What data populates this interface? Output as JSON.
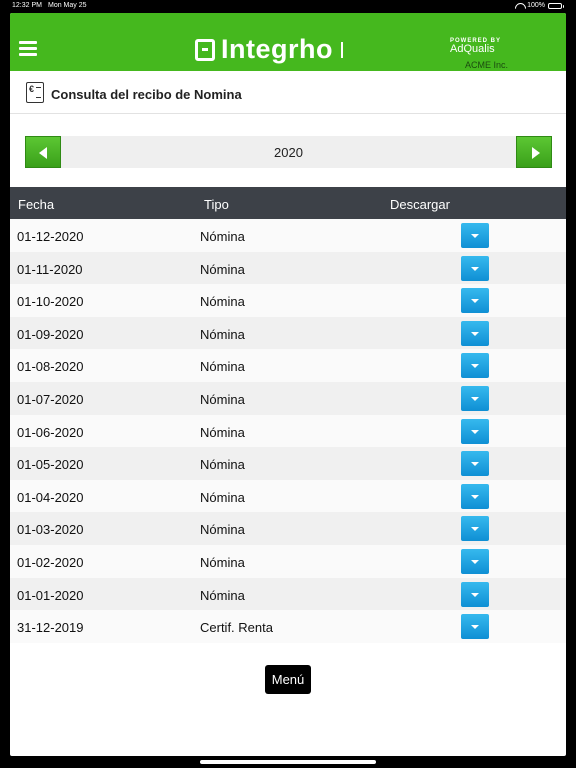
{
  "status": {
    "time": "12:32 PM",
    "date": "Mon May 25",
    "battery": "100%"
  },
  "header": {
    "brand": "Integrho",
    "powered_label": "POWERED BY",
    "powered_name": "AdQualis",
    "company": "ACME Inc."
  },
  "page": {
    "title": "Consulta del recibo de Nomina"
  },
  "year_selector": {
    "year": "2020"
  },
  "table": {
    "columns": [
      "Fecha",
      "Tipo",
      "Descargar"
    ],
    "rows": [
      {
        "fecha": "01-12-2020",
        "tipo": "Nómina"
      },
      {
        "fecha": "01-11-2020",
        "tipo": "Nómina"
      },
      {
        "fecha": "01-10-2020",
        "tipo": "Nómina"
      },
      {
        "fecha": "01-09-2020",
        "tipo": "Nómina"
      },
      {
        "fecha": "01-08-2020",
        "tipo": "Nómina"
      },
      {
        "fecha": "01-07-2020",
        "tipo": "Nómina"
      },
      {
        "fecha": "01-06-2020",
        "tipo": "Nómina"
      },
      {
        "fecha": "01-05-2020",
        "tipo": "Nómina"
      },
      {
        "fecha": "01-04-2020",
        "tipo": "Nómina"
      },
      {
        "fecha": "01-03-2020",
        "tipo": "Nómina"
      },
      {
        "fecha": "01-02-2020",
        "tipo": "Nómina"
      },
      {
        "fecha": "01-01-2020",
        "tipo": "Nómina"
      },
      {
        "fecha": "31-12-2019",
        "tipo": "Certif. Renta"
      }
    ]
  },
  "footer": {
    "menu_label": "Menú"
  },
  "colors": {
    "brand_green": "#45b81e",
    "header_dark": "#3d4148",
    "download_blue": "#1ea3e0"
  }
}
